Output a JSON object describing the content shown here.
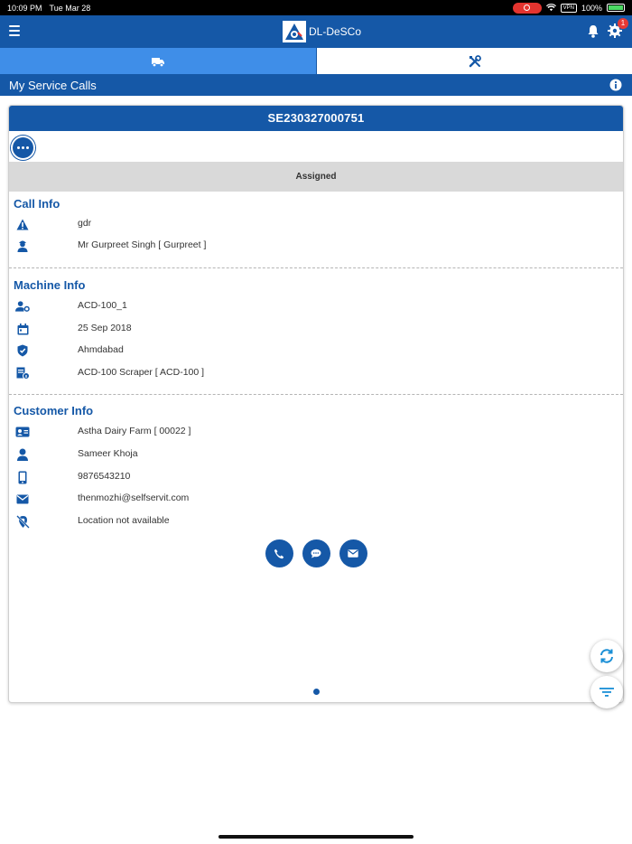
{
  "status_bar": {
    "time": "10:09 PM",
    "date": "Tue Mar 28",
    "vpn": "VPN",
    "battery": "100%"
  },
  "app": {
    "name": "DL-DeSCo",
    "notification_count": "1"
  },
  "tabs": [
    {
      "icon": "truck-icon"
    },
    {
      "icon": "tools-icon"
    }
  ],
  "page": {
    "title": "My Service Calls"
  },
  "call": {
    "id": "SE230327000751",
    "status": "Assigned",
    "call_info": {
      "heading": "Call Info",
      "problem": "gdr",
      "engineer": "Mr Gurpreet Singh [ Gurpreet ]"
    },
    "machine_info": {
      "heading": "Machine Info",
      "machine_id": "ACD-100_1",
      "date": "25 Sep 2018",
      "location": "Ahmdabad",
      "model": "ACD-100 Scraper [ ACD-100 ]"
    },
    "customer_info": {
      "heading": "Customer Info",
      "company": "Astha Dairy Farm [ 00022 ]",
      "contact": "Sameer Khoja",
      "phone": "9876543210",
      "email": "thenmozhi@selfservit.com",
      "geo": "Location not available"
    }
  },
  "colors": {
    "primary": "#1558a7",
    "tab_active": "#3f8ee8",
    "status_bg": "#d9d9d9"
  }
}
